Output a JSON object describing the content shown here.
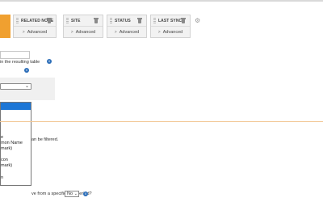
{
  "columns": [
    {
      "title": "RELATED NODE",
      "advanced": "Advanced"
    },
    {
      "title": "SITE",
      "advanced": "Advanced"
    },
    {
      "title": "STATUS",
      "advanced": "Advanced"
    },
    {
      "title": "LAST SYNC",
      "advanced": "Advanced"
    }
  ],
  "labels": {
    "resulting_table": "in the resulting table",
    "can_be_filtered": "an be filtered.",
    "time_period_question": "ve from a specific time period?"
  },
  "time_period_select": {
    "value": "No"
  },
  "dropdown_items": [
    "e",
    "mon Name",
    "mark)",
    "",
    "con",
    "mark)",
    "n"
  ],
  "colors": {
    "accent": "#f0a030",
    "info": "#2e6fb9",
    "highlight": "#1e77d6"
  }
}
